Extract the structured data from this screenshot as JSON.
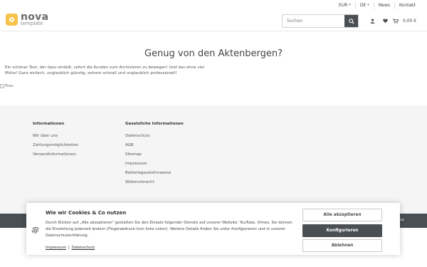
{
  "topbar": {
    "currency": "EUR",
    "language": "DE",
    "links": [
      "News",
      "Kontakt"
    ]
  },
  "header": {
    "logo_name": "nova",
    "logo_sub": "template",
    "search_placeholder": "Suchen",
    "cart_total": "0,00 €"
  },
  "main": {
    "headline": "Genug von den Aktenbergen?",
    "intro": "Ein schöner Text, der dazu einlädt, sofort die Kunden zum Archivieren zu bewegen! Und das ohne viel Mühe! Ganz einfach, unglaublich günstig, extrem schnell und unglaublich professionell!",
    "image_alt": "Frau"
  },
  "footer": {
    "col1_title": "Informationen",
    "col1_links": [
      "Wir über uns",
      "Zahlungsmöglichkeiten",
      "Versandinformationen"
    ],
    "col2_title": "Gesetzliche Informationen",
    "col2_links": [
      "Datenschutz",
      "AGB",
      "Sitemap",
      "Impressum",
      "Batteriegesetzhinweise",
      "Widerrufsrecht"
    ],
    "bottom_note": "k-Shop"
  },
  "cookie": {
    "title": "Wie wir Cookies & Co nutzen",
    "text_pre": "Durch Klicken auf „Alle akzeptieren\" gestatten Sie den Einsatz folgender Dienste auf unserer Website: YouTube, Vimeo. Sie können die Einstellung jederzeit ändern (Fingerabdruck-Icon links unten). Weitere Details finden Sie unter ",
    "text_em1": "Konfigurieren",
    "text_mid": " und in unserer ",
    "text_em2": "Datenschutzerklärung",
    "text_end": ".",
    "link_imprint": "Impressum",
    "link_sep": "|",
    "link_privacy": "Datenschutz",
    "btn_accept": "Alle akzeptieren",
    "btn_configure": "Konfigurieren",
    "btn_reject": "Ablehnen"
  },
  "colors": {
    "accent": "#f5c24a",
    "dark": "#4a4f54"
  }
}
